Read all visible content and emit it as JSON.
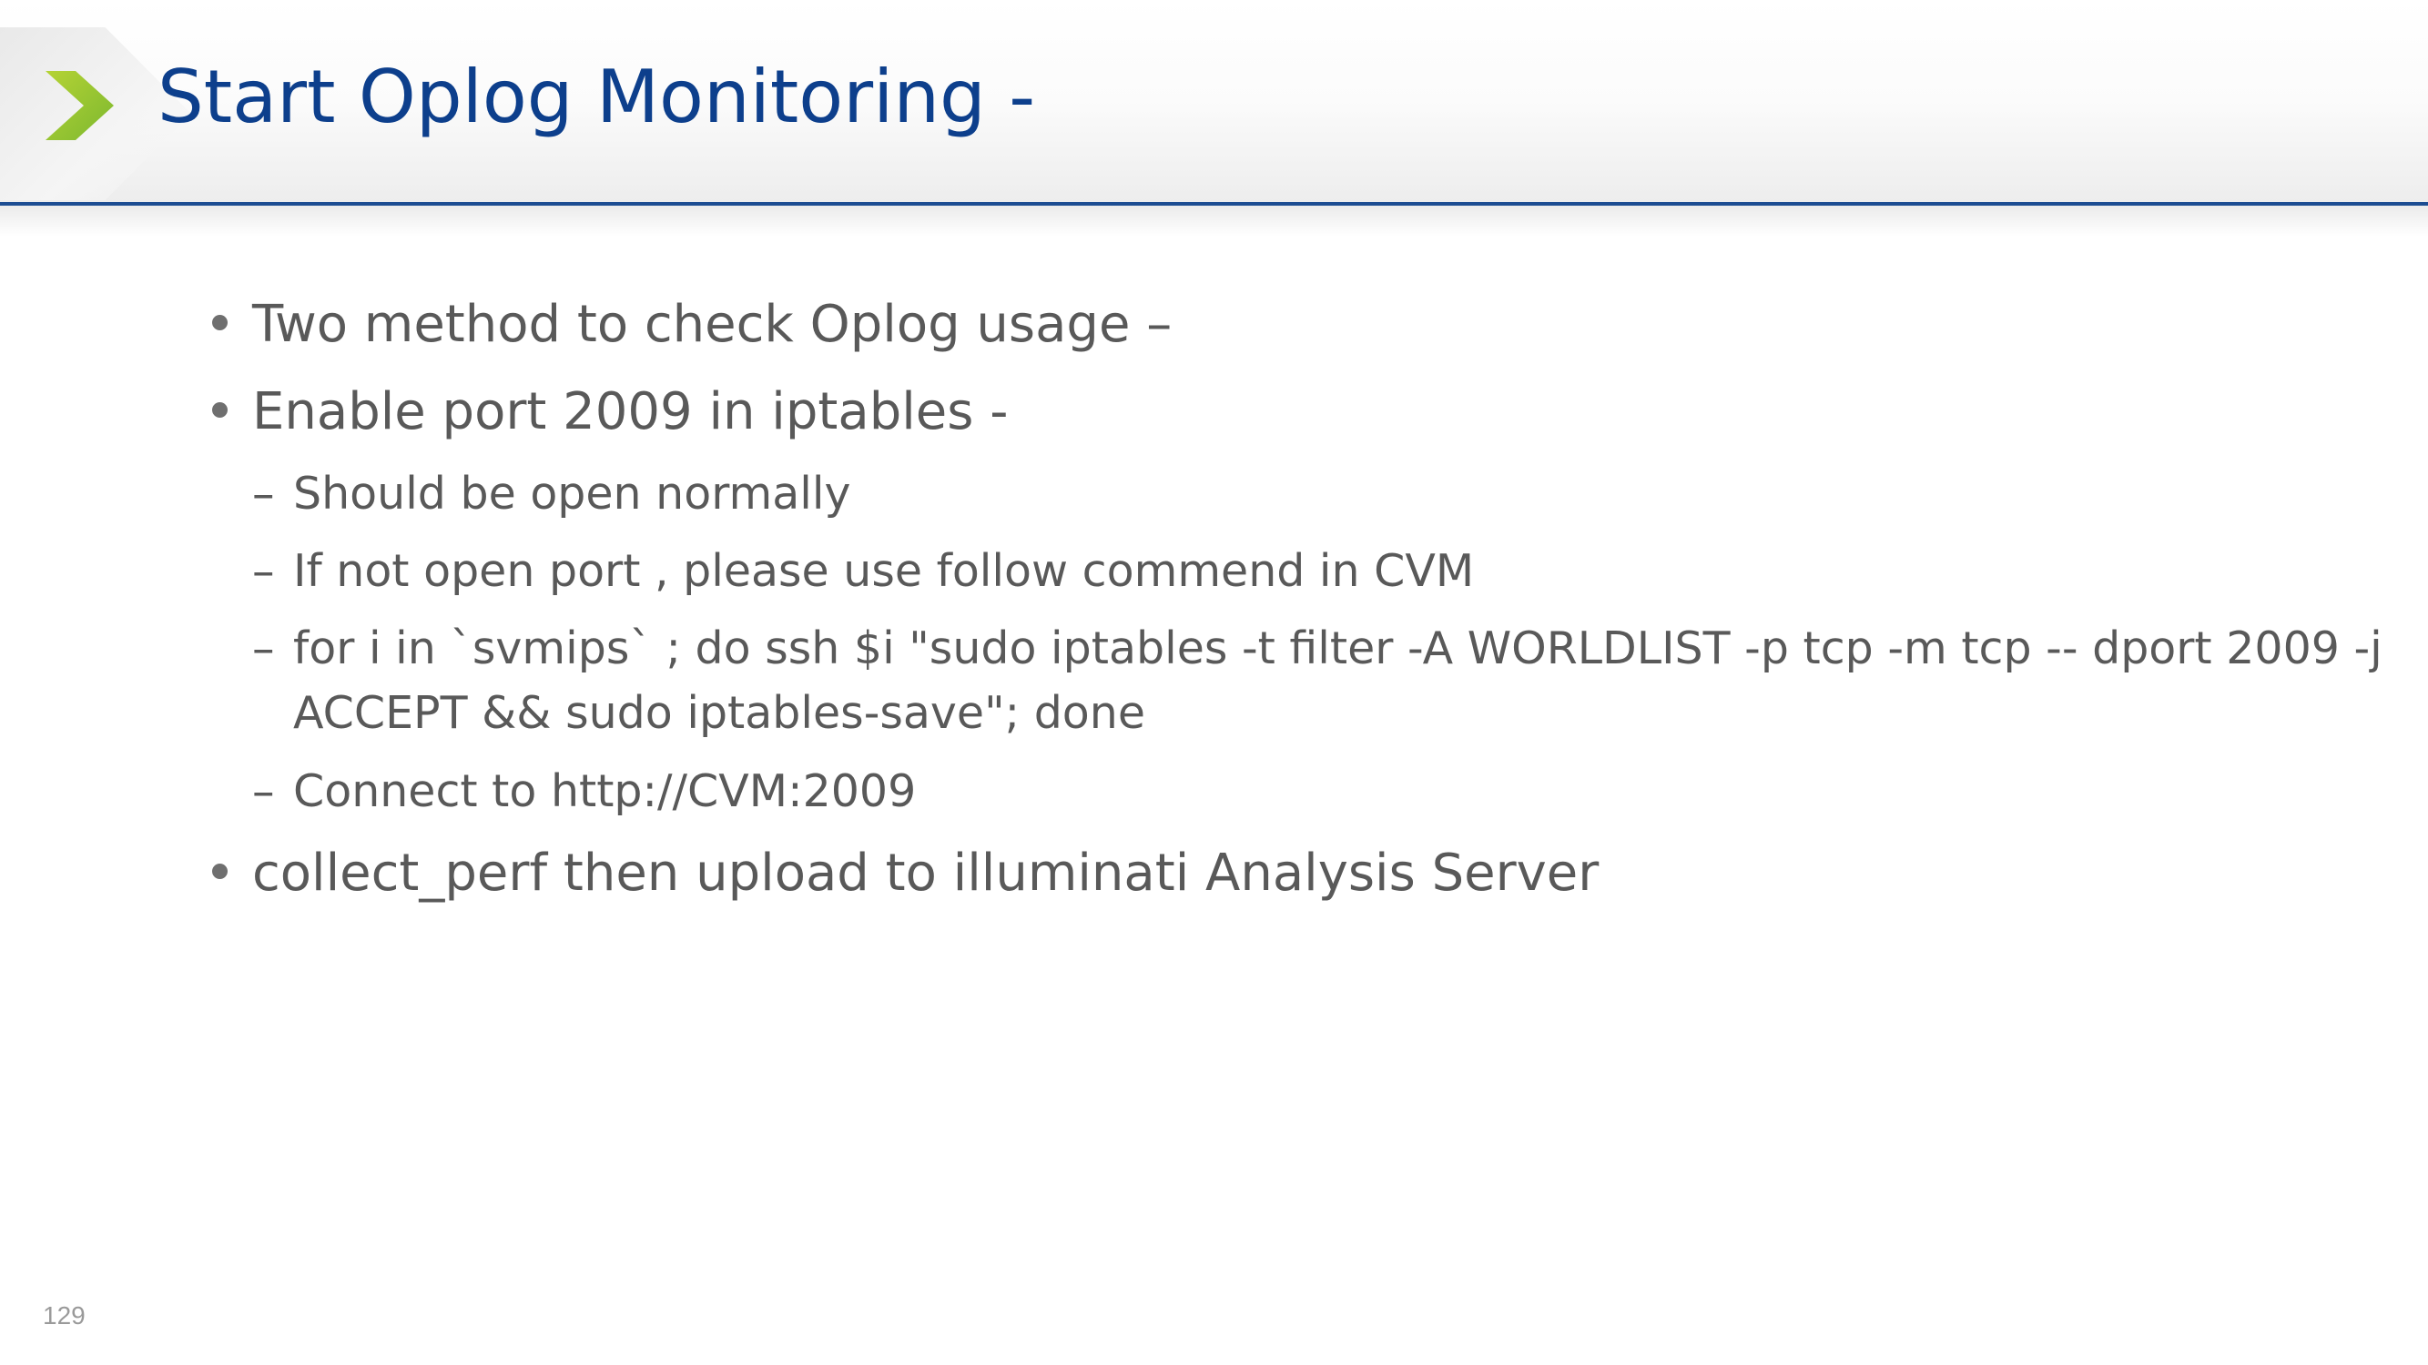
{
  "slide": {
    "title": "Start Oplog Monitoring  -",
    "page_number": "129",
    "colors": {
      "title": "#0d3f8c",
      "accent_green": "#8cc63f",
      "rule": "#1c4d92",
      "body_text": "#595959"
    },
    "logo_icon": "chevron-right-icon"
  },
  "bullets": [
    {
      "text": "Two method to check Oplog usage –"
    },
    {
      "text": "Enable port 2009 in iptables -"
    },
    {
      "text": "collect_perf  then upload to illuminati Analysis Server"
    }
  ],
  "sub_bullets": [
    {
      "dash": "–",
      "text": "Should be open normally"
    },
    {
      "dash": "–",
      "text": "If not open port , please use follow commend in CVM"
    },
    {
      "dash": "–",
      "text": "for i in `svmips` ; do ssh $i \"sudo iptables -t filter -A WORLDLIST -p tcp -m tcp -- dport 2009 -j",
      "text_cont": "ACCEPT && sudo iptables-save\"; done"
    },
    {
      "dash": "–",
      "text": "Connect to http://CVM:2009"
    }
  ]
}
